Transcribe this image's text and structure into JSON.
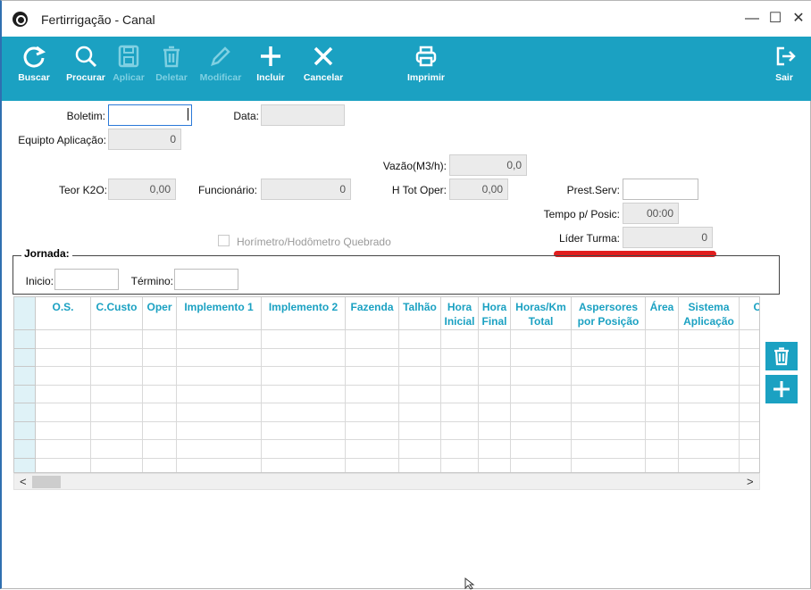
{
  "window": {
    "title": "Fertirrigação - Canal",
    "minimize": "—",
    "maximize": "☐",
    "close": "✕"
  },
  "toolbar": {
    "buscar": "Buscar",
    "procurar": "Procurar",
    "aplicar": "Aplicar",
    "deletar": "Deletar",
    "modificar": "Modificar",
    "incluir": "Incluir",
    "cancelar": "Cancelar",
    "imprimir": "Imprimir",
    "sair": "Sair"
  },
  "form": {
    "boletim_label": "Boletim:",
    "boletim_value": "",
    "data_label": "Data:",
    "data_value": "",
    "equipto_label": "Equipto Aplicação:",
    "equipto_value": "0",
    "vazao_label": "Vazão(M3/h):",
    "vazao_value": "0,0",
    "teor_label": "Teor K2O:",
    "teor_value": "0,00",
    "funcionario_label": "Funcionário:",
    "funcionario_value": "0",
    "htot_label": "H Tot Oper:",
    "htot_value": "0,00",
    "prest_label": "Prest.Serv:",
    "prest_value": "",
    "tempo_label": "Tempo p/ Posic:",
    "tempo_value": "00:00",
    "horimetro_label": "Horímetro/Hodômetro Quebrado",
    "lider_label": "Líder Turma:",
    "lider_value": "0"
  },
  "jornada": {
    "title": "Jornada:",
    "inicio_label": "Inicio:",
    "inicio_value": "",
    "termino_label": "Término:",
    "termino_value": ""
  },
  "grid": {
    "columns": [
      "O.S.",
      "C.Custo",
      "Oper",
      "Implemento 1",
      "Implemento 2",
      "Fazenda",
      "Talhão",
      "Hora\nInicial",
      "Hora\nFinal",
      "Horas/Km\nTotal",
      "Aspersores\npor Posição",
      "Área",
      "Sistema\nAplicação",
      "Co"
    ]
  },
  "scroll": {
    "left": "<",
    "right": ">"
  },
  "colors": {
    "accent": "#1ba1c2",
    "highlight": "#e11d1d"
  },
  "icons": [
    "refresh-icon",
    "search-icon",
    "save-icon",
    "trash-icon",
    "pencil-icon",
    "plus-icon",
    "x-icon",
    "printer-icon",
    "exit-icon"
  ]
}
